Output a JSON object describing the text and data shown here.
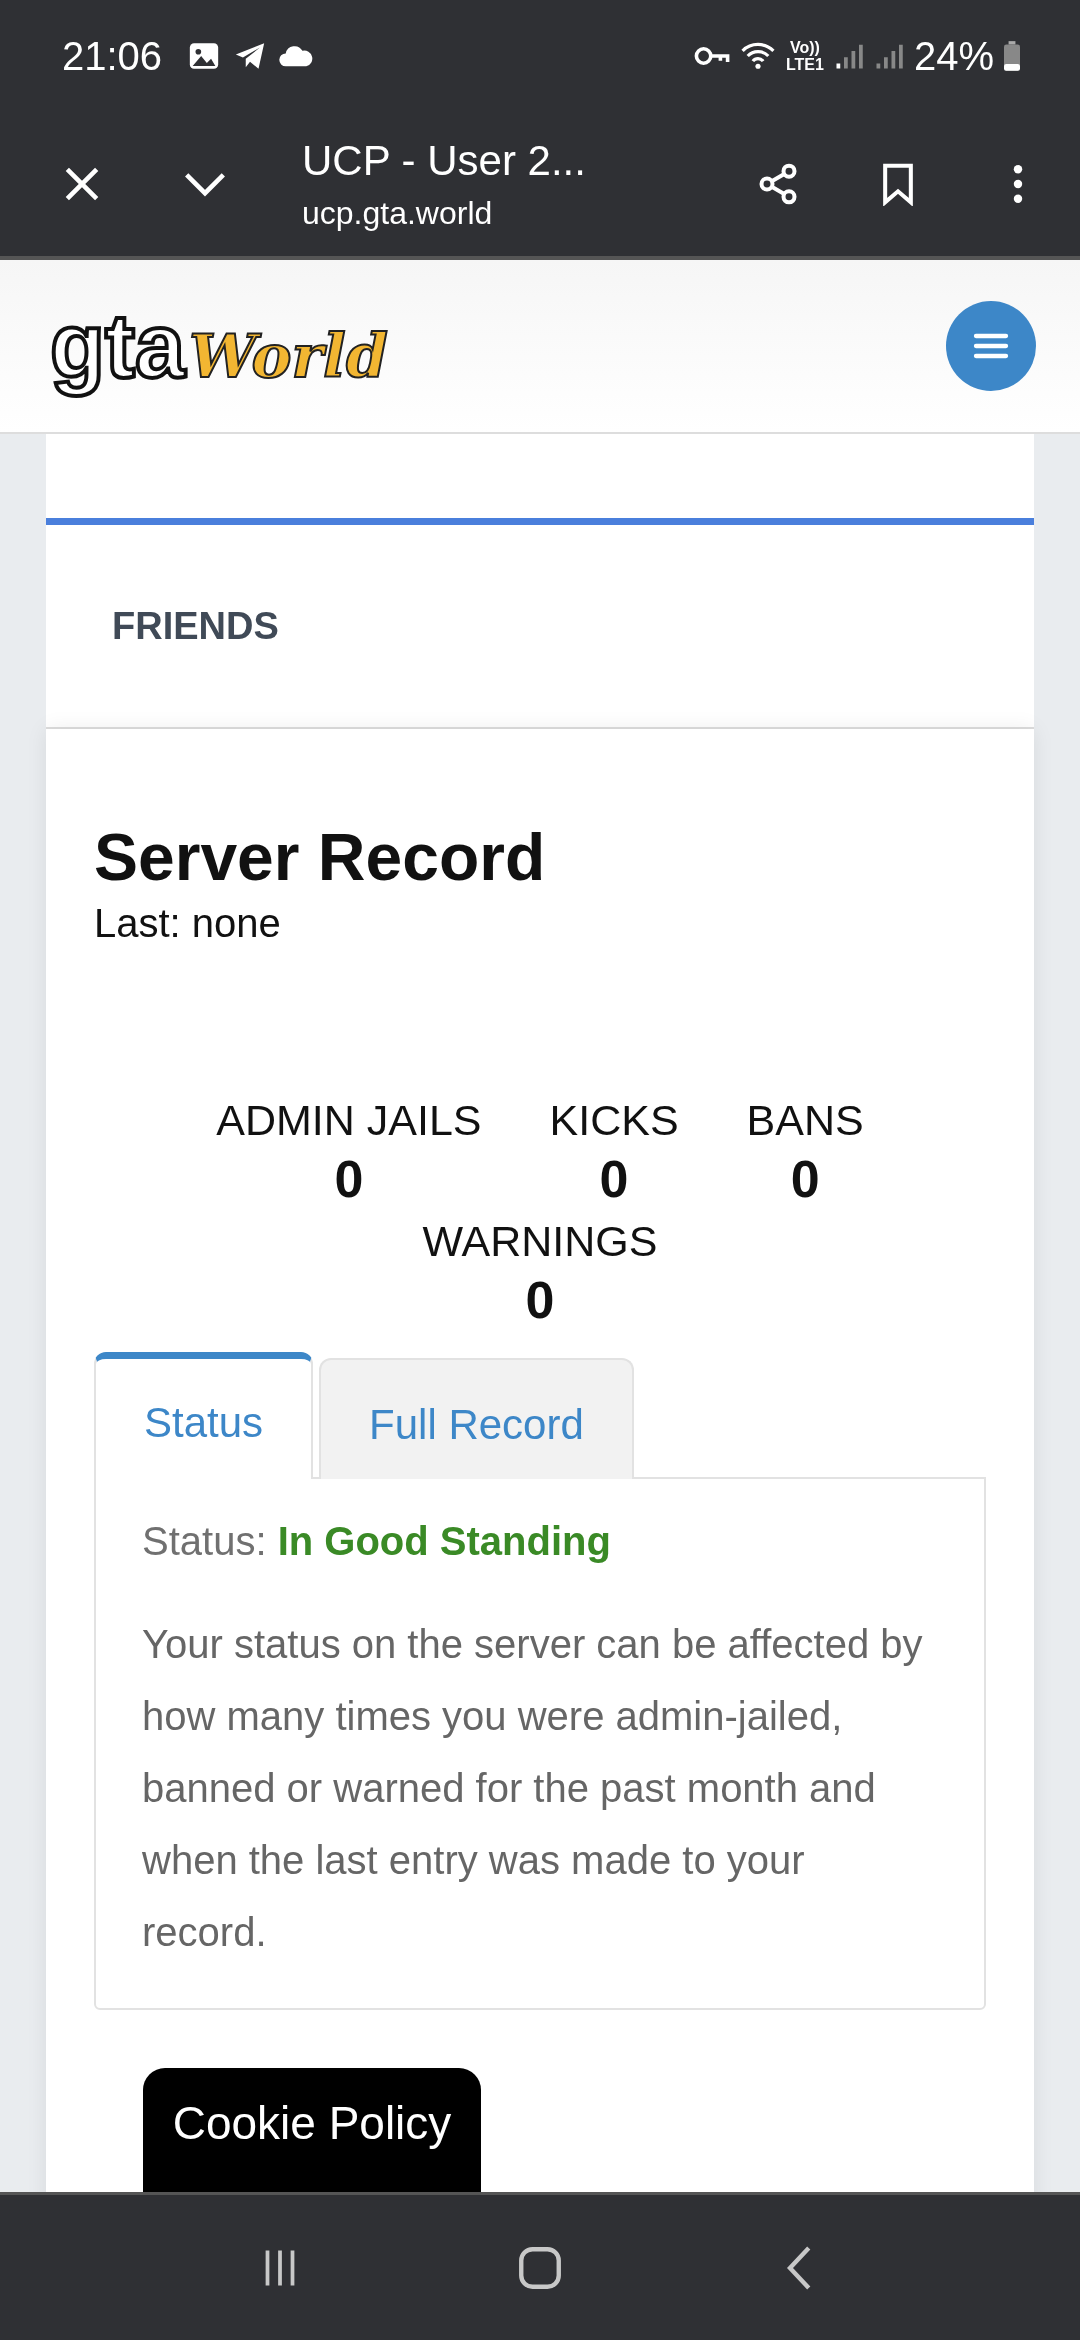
{
  "status_bar": {
    "time": "21:06",
    "volte_top": "Vo))",
    "volte_bottom": "LTE1",
    "battery": "24%"
  },
  "browser_bar": {
    "title": "UCP - User 2...",
    "url": "ucp.gta.world"
  },
  "header": {
    "logo": {
      "mark": "gta",
      "script": "World"
    }
  },
  "friends": {
    "label": "FRIENDS"
  },
  "record": {
    "title": "Server Record",
    "last": "Last: none",
    "stats": [
      {
        "label": "ADMIN JAILS",
        "value": "0"
      },
      {
        "label": "KICKS",
        "value": "0"
      },
      {
        "label": "BANS",
        "value": "0"
      },
      {
        "label": "WARNINGS",
        "value": "0"
      }
    ],
    "tabs": [
      {
        "label": "Status",
        "selected": true
      },
      {
        "label": "Full Record",
        "selected": false
      }
    ],
    "status_label": "Status:",
    "status_value": "In Good Standing",
    "description": "Your status on the server can be affected by how many times you were admin-jailed, banned or warned for the past month and when the last entry was made to your record."
  },
  "cookie_button": "Cookie Policy"
}
